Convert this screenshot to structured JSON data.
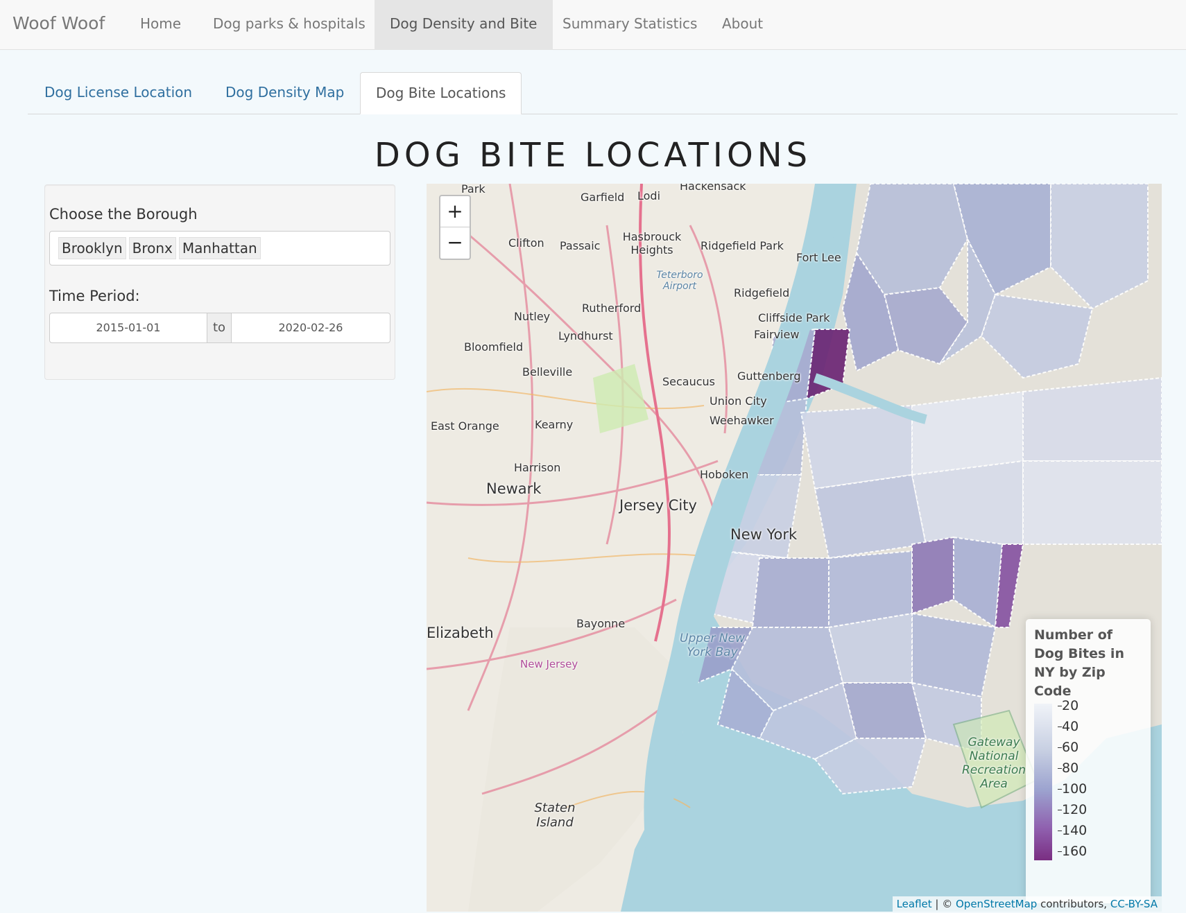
{
  "navbar": {
    "brand": "Woof Woof",
    "items": [
      "Home",
      "Dog parks & hospitals",
      "Dog Density and Bite",
      "Summary Statistics",
      "About"
    ],
    "active_index": 2
  },
  "tabs": {
    "items": [
      "Dog License Location",
      "Dog Density Map",
      "Dog Bite Locations"
    ],
    "active_index": 2
  },
  "page_title": "DOG BITE LOCATIONS",
  "sidebar": {
    "borough_label": "Choose the Borough",
    "boroughs_selected": [
      "Brooklyn",
      "Bronx",
      "Manhattan"
    ],
    "time_label": "Time Period:",
    "date_start": "2015-01-01",
    "date_sep": "to",
    "date_end": "2020-02-26"
  },
  "map": {
    "zoom_in": "+",
    "zoom_out": "−",
    "place_labels": [
      "Park",
      "Hackensack",
      "Garfield",
      "Lodi",
      "Clifton",
      "Passaic",
      "Hasbrouck Heights",
      "Ridgefield Park",
      "Fort Lee",
      "Teterboro Airport",
      "Rutherford",
      "Ridgefield",
      "Nutley",
      "Cliffside Park",
      "Fairview",
      "Lyndhurst",
      "Bloomfield",
      "Belleville",
      "Secaucus",
      "Guttenberg",
      "Union City",
      "Weehawker",
      "East Orange",
      "Kearny",
      "Harrison",
      "Newark",
      "Jersey City",
      "Hoboken",
      "New York",
      "Bayonne",
      "Elizabeth",
      "Upper New York Bay",
      "New Jersey",
      "Staten Island",
      "Gateway National Recreation Area"
    ],
    "legend": {
      "title": "Number of Dog Bites in NY by Zip Code",
      "ticks": [
        "20",
        "40",
        "60",
        "80",
        "100",
        "120",
        "140",
        "160"
      ],
      "colors": [
        "#f0f3f8",
        "#7a2e82"
      ]
    },
    "attribution": {
      "leaflet": "Leaflet",
      "sep": " | © ",
      "osm": "OpenStreetMap",
      "contrib": " contributors, ",
      "license": "CC-BY-SA"
    }
  }
}
